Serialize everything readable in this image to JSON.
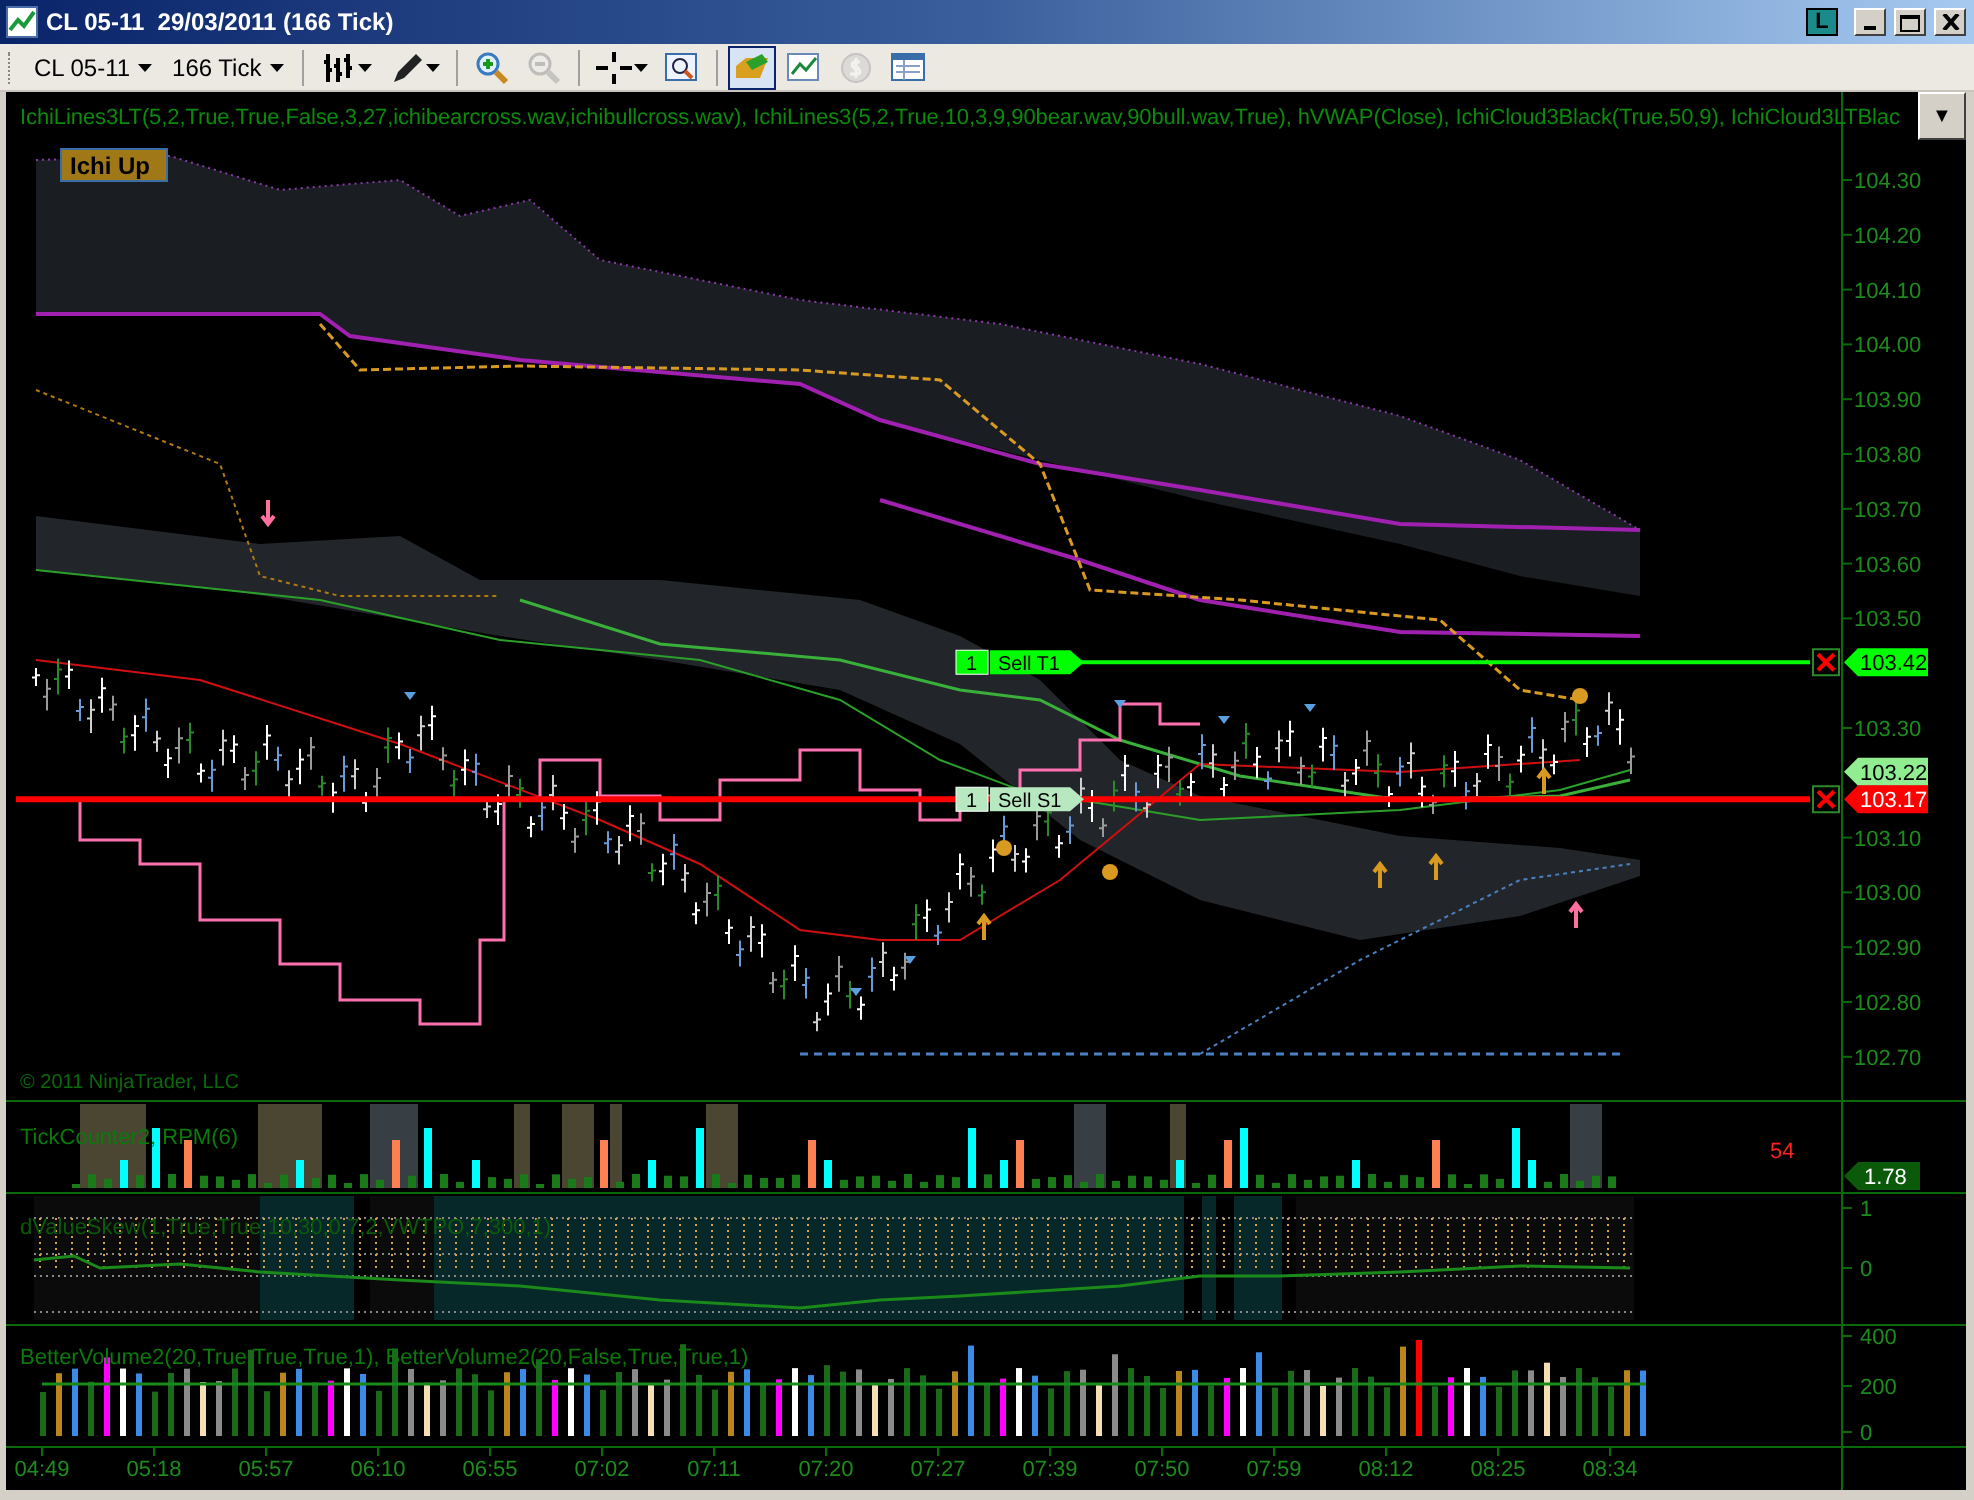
{
  "window": {
    "title": "CL 05-11  29/03/2011 (166 Tick)",
    "link_button": "L"
  },
  "toolbar": {
    "instrument": "CL 05-11",
    "period": "166 Tick",
    "buttons": [
      {
        "pressed": false,
        "disabled": false
      },
      {
        "pressed": false,
        "disabled": false
      },
      {
        "pressed": false,
        "disabled": false
      },
      {
        "pressed": false,
        "disabled": true
      },
      {
        "pressed": false,
        "disabled": false
      },
      {
        "pressed": false,
        "disabled": false
      },
      {
        "pressed": true,
        "disabled": false
      },
      {
        "pressed": false,
        "disabled": false
      },
      {
        "pressed": false,
        "disabled": true
      },
      {
        "pressed": false,
        "disabled": false
      }
    ]
  },
  "price_panel": {
    "indicators_label": "IchiLines3LT(5,2,True,True,False,3,27,ichibearcross.wav,ichibullcross.wav), IchiLines3(5,2,True,10,3,9,90bear.wav,90bull.wav,True), hVWAP(Close), IchiCloud3Black(True,50,9), IchiCloud3LTBlac",
    "menu_button": "▼",
    "badge": "Ichi Up",
    "copyright": "© 2011 NinjaTrader, LLC",
    "axis_labels": [
      "104.30",
      "104.20",
      "104.10",
      "104.00",
      "103.90",
      "103.80",
      "103.70",
      "103.60",
      "103.50",
      "103.30",
      "103.10",
      "103.00",
      "102.90",
      "102.80",
      "102.70"
    ],
    "orders": [
      {
        "quantity": "1",
        "label": "Sell T1",
        "color": "#00ff00"
      },
      {
        "quantity": "1",
        "label": "Sell S1",
        "color": "#ff0000"
      }
    ],
    "price_markers": [
      {
        "value": "103.42",
        "color": "#00ff00"
      },
      {
        "value": "103.22",
        "color": "#90ee90"
      },
      {
        "value": "103.17",
        "color": "#ff0000"
      }
    ]
  },
  "tick_panel": {
    "label": "TickCounter2, RPM(6)",
    "count": "54",
    "marker": "1.78"
  },
  "skew_panel": {
    "label": "dValueSkew(1,True,True,10,30,0.7,2,VWTPO,7,300,1)",
    "axis_labels": [
      "1",
      "0"
    ]
  },
  "volume_panel": {
    "label": "BetterVolume2(20,True,True,True,1), BetterVolume2(20,False,True,True,1)",
    "axis_labels": [
      "400",
      "200",
      "0"
    ]
  },
  "time_axis": [
    "04:49",
    "05:18",
    "05:57",
    "06:10",
    "06:55",
    "07:02",
    "07:11",
    "07:20",
    "07:27",
    "07:39",
    "07:50",
    "07:59",
    "08:12",
    "08:25",
    "08:34"
  ]
}
